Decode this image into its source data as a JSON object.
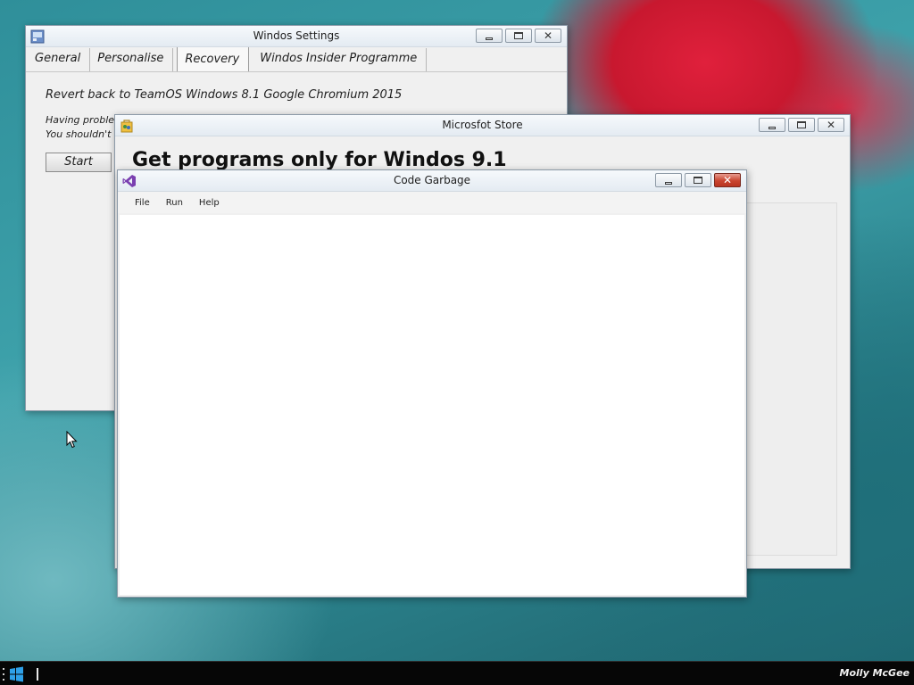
{
  "settings_window": {
    "title": "Windos Settings",
    "icon": "settings-app-icon",
    "tabs": [
      {
        "label": "General"
      },
      {
        "label": "Personalise"
      },
      {
        "label": "Recovery",
        "active": true
      },
      {
        "label": "Windos Insider Programme"
      }
    ],
    "heading": "Revert back to TeamOS Windows 8.1 Google Chromium 2015",
    "line1": "Having proble",
    "line2": "You shouldn't",
    "start_button": "Start"
  },
  "store_window": {
    "title": "Microsfot Store",
    "icon": "store-app-icon",
    "heading": "Get programs only for Windos 9.1"
  },
  "code_window": {
    "title": "Code Garbage",
    "icon": "visual-studio-icon",
    "menu": [
      "File",
      "Run",
      "Help"
    ]
  },
  "taskbar": {
    "user_name": "Molly McGee",
    "start_icon": "windows-logo-icon"
  },
  "colors": {
    "close_button_active": "#c9442f",
    "taskbar": "#060606",
    "window_bg": "#f0f0f0"
  }
}
